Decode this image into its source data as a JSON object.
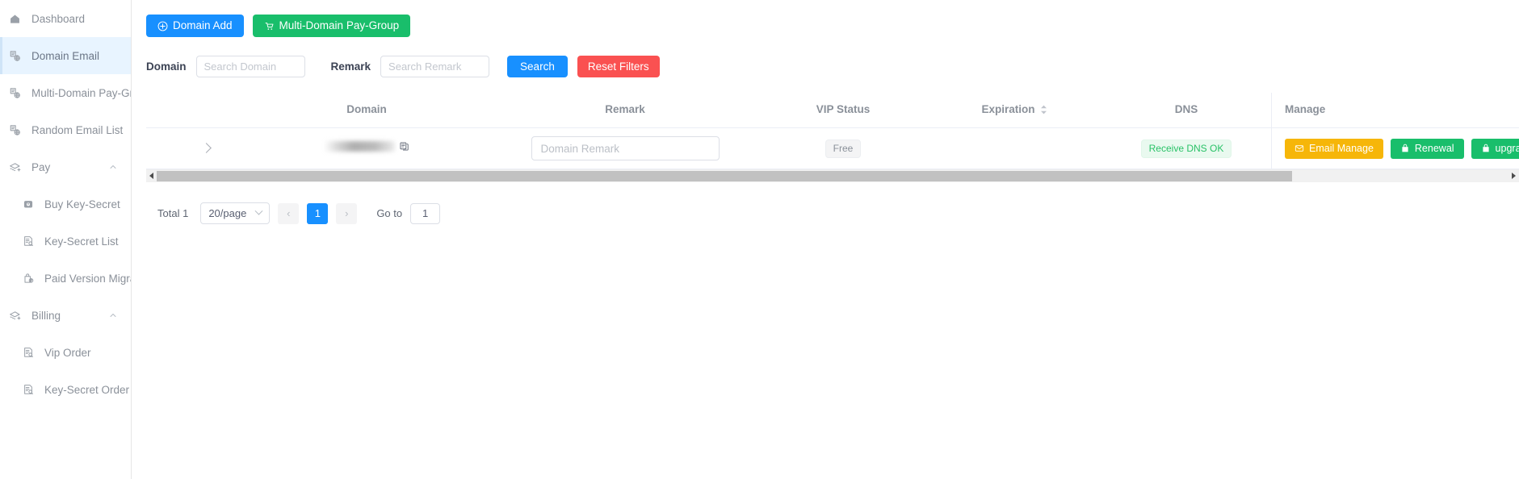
{
  "sidebar": {
    "items": [
      {
        "label": "Dashboard",
        "icon": "home-icon",
        "level": "top",
        "active": false,
        "group": false
      },
      {
        "label": "Domain Email",
        "icon": "domain-email-icon",
        "level": "top",
        "active": true,
        "group": false
      },
      {
        "label": "Multi-Domain Pay-Group",
        "icon": "domain-email-icon",
        "level": "top",
        "active": false,
        "group": false
      },
      {
        "label": "Random Email List",
        "icon": "domain-email-icon",
        "level": "top",
        "active": false,
        "group": false
      },
      {
        "label": "Pay",
        "icon": "pay-icon",
        "level": "top",
        "active": false,
        "group": true
      },
      {
        "label": "Buy Key-Secret",
        "icon": "wallet-icon",
        "level": "sub",
        "active": false,
        "group": false
      },
      {
        "label": "Key-Secret List",
        "icon": "list-doc-icon",
        "level": "sub",
        "active": false,
        "group": false
      },
      {
        "label": "Paid Version Migration",
        "icon": "upload-bag-icon",
        "level": "sub",
        "active": false,
        "group": false
      },
      {
        "label": "Billing",
        "icon": "pay-icon",
        "level": "top",
        "active": false,
        "group": true
      },
      {
        "label": "Vip Order",
        "icon": "list-doc-icon",
        "level": "sub",
        "active": false,
        "group": false
      },
      {
        "label": "Key-Secret Order",
        "icon": "list-doc-icon",
        "level": "sub",
        "active": false,
        "group": false
      }
    ]
  },
  "toolbar": {
    "domain_add_label": "Domain Add",
    "domain_add_icon": "plus-circle-icon",
    "multi_domain_label": "Multi-Domain Pay-Group",
    "multi_domain_icon": "cart-icon"
  },
  "filters": {
    "domain_label": "Domain",
    "domain_placeholder": "Search Domain",
    "domain_value": "",
    "remark_label": "Remark",
    "remark_placeholder": "Search Remark",
    "remark_value": "",
    "search_label": "Search",
    "reset_label": "Reset Filters"
  },
  "table": {
    "columns": [
      {
        "label": "",
        "key": "expand"
      },
      {
        "label": "Domain",
        "key": "domain"
      },
      {
        "label": "Remark",
        "key": "remark"
      },
      {
        "label": "VIP Status",
        "key": "vip_status"
      },
      {
        "label": "Expiration",
        "key": "expiration",
        "sortable": true
      },
      {
        "label": "DNS",
        "key": "dns"
      },
      {
        "label": "Manage",
        "key": "manage"
      }
    ],
    "rows": [
      {
        "domain": "",
        "domain_masked": true,
        "copy_icon": "copy-icon",
        "remark_placeholder": "Domain Remark",
        "remark_value": "",
        "vip_status": "Free",
        "expiration": "",
        "dns": "Receive DNS OK",
        "manage": [
          {
            "label": "Email Manage",
            "icon": "envelope-icon",
            "style": "yellow"
          },
          {
            "label": "Renewal",
            "icon": "bag-icon",
            "style": "green"
          },
          {
            "label": "upgrade",
            "icon": "bag-icon",
            "style": "green"
          }
        ]
      }
    ]
  },
  "pagination": {
    "total_label": "Total 1",
    "page_size_label": "20/page",
    "prev_label": "‹",
    "next_label": "›",
    "current_page": "1",
    "goto_label": "Go to",
    "goto_value": "1"
  },
  "colors": {
    "primary": "#1890ff",
    "green": "#19be6b",
    "red": "#fa5151",
    "yellow": "#f6b609",
    "dns_green": "#29c267",
    "sidebar_active_bg": "#e8f4ff"
  }
}
